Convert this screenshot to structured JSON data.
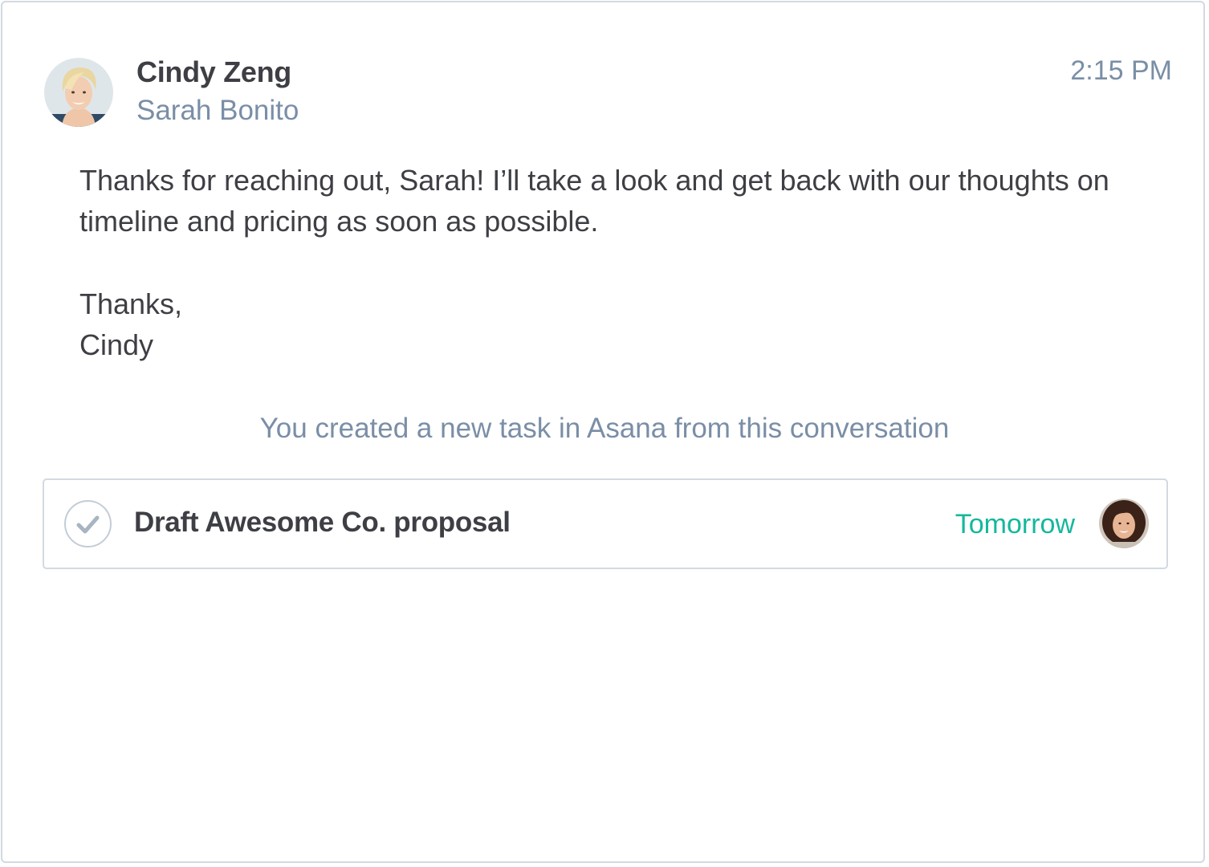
{
  "message": {
    "sender": "Cindy Zeng",
    "recipient": "Sarah Bonito",
    "time": "2:15 PM",
    "body": "Thanks for reaching out, Sarah! I’ll take a look and get back with our thoughts on timeline and pricing as soon as possible.",
    "closing": "Thanks,",
    "signature": "Cindy"
  },
  "notice": "You created a new task in Asana from this conversation",
  "task": {
    "title": "Draft Awesome Co. proposal",
    "due": "Tomorrow",
    "completed": false
  },
  "colors": {
    "accent_green": "#14b89c",
    "muted_blue": "#7a8ea6",
    "border": "#d3d9e1"
  },
  "icons": [
    "sender-avatar",
    "check-icon",
    "assignee-avatar"
  ]
}
